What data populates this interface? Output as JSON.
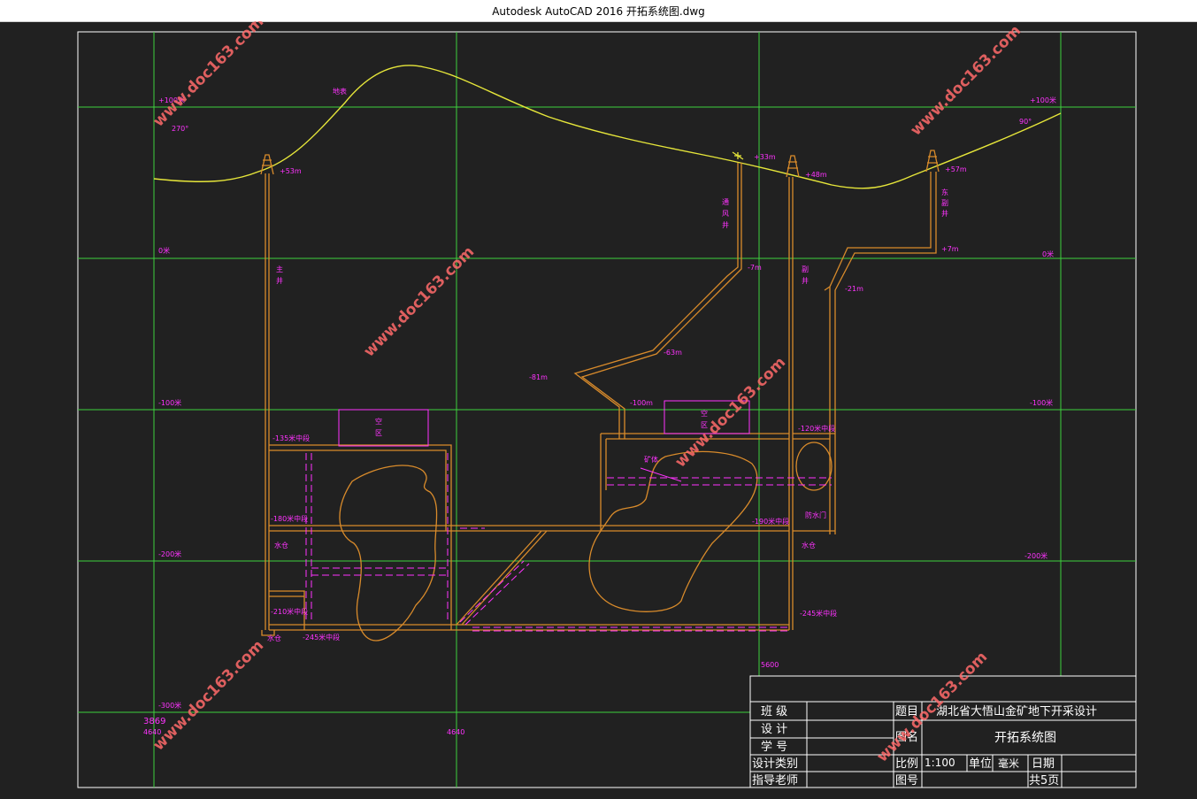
{
  "window": {
    "title": "Autodesk AutoCAD 2016    开拓系统图.dwg"
  },
  "elevations": {
    "left": [
      "+100米",
      "0米",
      "-100米",
      "-200米",
      "-300米"
    ],
    "right": [
      "+100米",
      "0米",
      "-100米",
      "-200米"
    ]
  },
  "bearings": {
    "left": "270°",
    "right": "90°"
  },
  "labels": {
    "surface": "地表",
    "main_shaft": [
      "主",
      "井"
    ],
    "vent_shaft": [
      "通",
      "风",
      "井"
    ],
    "aux_shaft": [
      "副",
      "井"
    ],
    "east_vent": [
      "东",
      "副",
      "井"
    ],
    "lvl_53": "+53m",
    "lvl_33": "+33m",
    "lvl_48": "+48m",
    "lvl_57": "+57m",
    "lvl_7": "+7m",
    "lvl_m7": "-7m",
    "lvl_m21": "-21m",
    "lvl_m63": "-63m",
    "lvl_m81": "-81m",
    "lvl_m100": "-100m",
    "empty_zone_1": [
      "空",
      "区"
    ],
    "empty_zone_2": [
      "空",
      "区"
    ],
    "ore_body": "矿体",
    "lvl_135": "-135米中段",
    "lvl_120": "-120米中段",
    "lvl_180": "-180米中段",
    "lvl_190": "-190米中段",
    "lvl_210": "-210米中段",
    "lvl_245_left": "-245米中段",
    "lvl_245_right": "-245米中段",
    "sump_1": "水仓",
    "sump_2": "水仓",
    "sump_3": "水仓",
    "water_door": "防水门"
  },
  "dims": {
    "d1": "3869",
    "d2": "4640",
    "d3": "4640",
    "d4": "5600"
  },
  "title_block": {
    "class_label": "班 级",
    "design_label": "设 计",
    "student_no_label": "学 号",
    "design_type_label": "设计类别",
    "advisor_label": "指导老师",
    "topic_label": "题目",
    "topic_value": "湖北省大悟山金矿地下开采设计",
    "drawing_name_label": "图名",
    "drawing_name_value": "开拓系统图",
    "scale_label": "比例",
    "scale_value": "1:100",
    "unit_label": "单位",
    "unit_value": "毫米",
    "date_label": "日期",
    "drawing_no_label": "图号",
    "pages_value": "共5页"
  },
  "watermark": "www.doc163.com",
  "colors": {
    "background": "#212121",
    "grid": "#3dd13d",
    "surface": "#e6e63a",
    "workings": "#d98b2b",
    "annotation": "#ff33ff",
    "frame": "#ffffff"
  }
}
